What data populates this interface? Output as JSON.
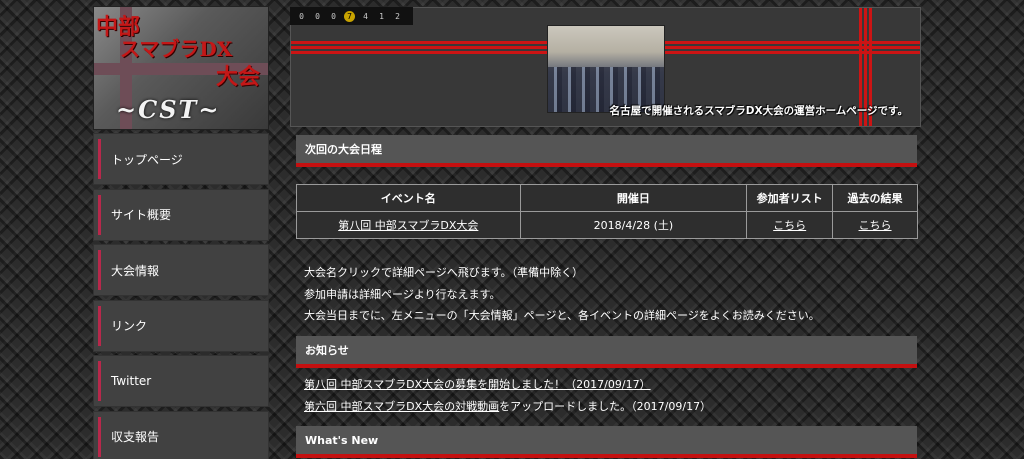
{
  "logo": {
    "line1": "中部",
    "line2": "スマブラDX",
    "line3": "大会",
    "line4": "~CST~"
  },
  "sidebar": {
    "items": [
      {
        "label": "トップページ"
      },
      {
        "label": "サイト概要"
      },
      {
        "label": "大会情報"
      },
      {
        "label": "リンク"
      },
      {
        "label": "Twitter"
      },
      {
        "label": "収支報告"
      }
    ]
  },
  "counter": {
    "digits": [
      "0",
      "0",
      "0",
      "7",
      "4",
      "1",
      "2"
    ]
  },
  "banner": {
    "caption": "名古屋で開催されるスマブラDX大会の運営ホームページです。"
  },
  "schedule": {
    "title": "次回の大会日程",
    "columns": [
      "イベント名",
      "開催日",
      "参加者リスト",
      "過去の結果"
    ],
    "rows": [
      {
        "event": "第八回 中部スマブラDX大会",
        "date": "2018/4/28 (土)",
        "participants": "こちら",
        "results": "こちら"
      }
    ]
  },
  "notes": [
    "大会名クリックで詳細ページへ飛びます。（準備中除く）",
    "参加申請は詳細ページより行なえます。",
    "大会当日までに、左メニューの「大会情報」ページと、各イベントの詳細ページをよくお読みください。"
  ],
  "news": {
    "title": "お知らせ",
    "items": [
      {
        "link": "第八回 中部スマブラDX大会の募集を開始しました！（2017/09/17）",
        "rest": ""
      },
      {
        "link": "第六回 中部スマブラDX大会の対戦動画",
        "rest": "をアップロードしました。（2017/09/17）"
      }
    ]
  },
  "whats_new": {
    "title": "What's New"
  },
  "colors": {
    "accent": "#cc1414",
    "nav_marker": "#b8284b",
    "header_bg": "#555555"
  }
}
